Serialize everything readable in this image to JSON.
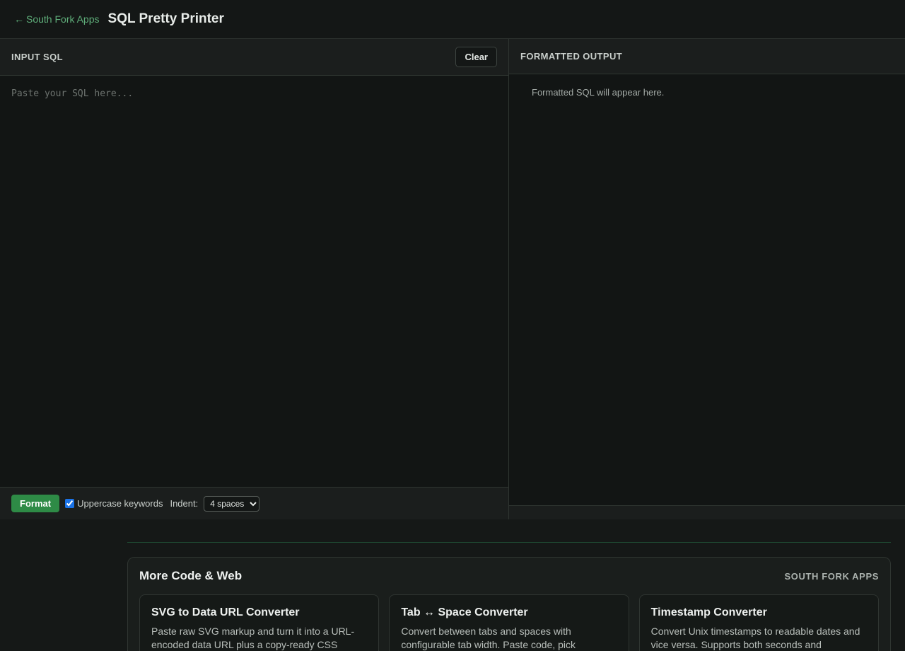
{
  "header": {
    "back_arrow": "←",
    "back_label": "South Fork Apps",
    "title": "SQL Pretty Printer"
  },
  "input_pane": {
    "label": "INPUT SQL",
    "clear_label": "Clear",
    "placeholder": "Paste your SQL here...",
    "value": ""
  },
  "output_pane": {
    "label": "FORMATTED OUTPUT",
    "placeholder_text": "Formatted SQL will appear here."
  },
  "toolbar": {
    "format_label": "Format",
    "uppercase_label": "Uppercase keywords",
    "uppercase_checked": true,
    "indent_label": "Indent:",
    "indent_selected": "4 spaces"
  },
  "more_section": {
    "title": "More Code & Web",
    "brand": "SOUTH FORK APPS",
    "tools": [
      {
        "name": "SVG to Data URL Converter",
        "description": "Paste raw SVG markup and turn it into a URL-encoded data URL plus a copy-ready CSS"
      },
      {
        "name": "Tab ↔ Space Converter",
        "description": "Convert between tabs and spaces with configurable tab width. Paste code, pick"
      },
      {
        "name": "Timestamp Converter",
        "description": "Convert Unix timestamps to readable dates and vice versa. Supports both seconds and"
      }
    ]
  },
  "colors": {
    "background": "#121514",
    "panel": "#1b1e1d",
    "accent_green": "#2e8b46",
    "link_green": "#5fae7a"
  },
  "icons": {
    "back": "arrow-left-icon"
  }
}
